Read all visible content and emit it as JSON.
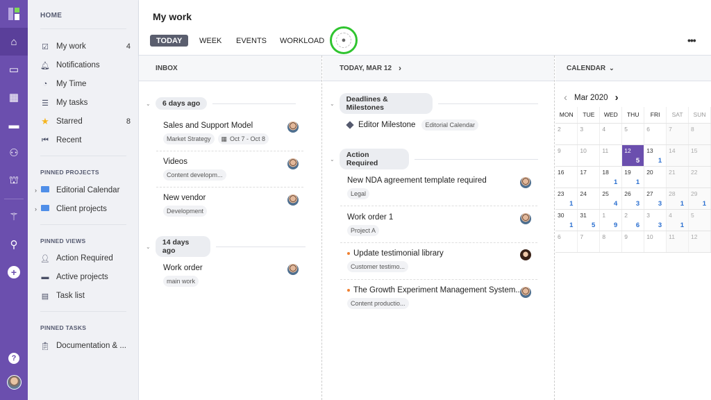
{
  "rail": {
    "icons": [
      "logo-icon",
      "home-icon",
      "briefcase-icon",
      "dashboard-icon",
      "chat-icon",
      "users-icon",
      "bank-icon",
      "magic-wand-icon",
      "search-icon",
      "add-icon",
      "help-icon",
      "user-avatar"
    ],
    "help_label": "?"
  },
  "sidebar": {
    "home_heading": "HOME",
    "home_items": [
      {
        "label": "My work",
        "count": "4",
        "icon": "checkbox-icon"
      },
      {
        "label": "Notifications",
        "count": "",
        "icon": "bell-icon"
      },
      {
        "label": "My Time",
        "count": "",
        "icon": "timer-icon"
      },
      {
        "label": "My tasks",
        "count": "",
        "icon": "checklist-icon"
      },
      {
        "label": "Starred",
        "count": "8",
        "icon": "star-icon"
      },
      {
        "label": "Recent",
        "count": "",
        "icon": "recent-icon"
      }
    ],
    "pinned_projects_heading": "PINNED PROJECTS",
    "pinned_projects": [
      {
        "label": "Editorial Calendar"
      },
      {
        "label": "Client projects"
      }
    ],
    "pinned_views_heading": "PINNED VIEWS",
    "pinned_views": [
      {
        "label": "Action Required"
      },
      {
        "label": "Active projects"
      },
      {
        "label": "Task list"
      }
    ],
    "pinned_tasks_heading": "PINNED TASKS",
    "pinned_tasks": [
      {
        "label": "Documentation & ..."
      }
    ]
  },
  "header": {
    "title": "My work",
    "tabs": [
      {
        "label": "TODAY",
        "active": true
      },
      {
        "label": "WEEK"
      },
      {
        "label": "EVENTS"
      },
      {
        "label": "WORKLOAD"
      }
    ],
    "more_label": "•••",
    "person_icon": "👤"
  },
  "inbox": {
    "heading": "INBOX",
    "groups": [
      {
        "label": "6 days ago",
        "tasks": [
          {
            "title": "Sales and Support Model",
            "tags": [
              "Market Strategy"
            ],
            "date": "Oct 7 - Oct 8"
          },
          {
            "title": "Videos",
            "tags": [
              "Content developm..."
            ]
          },
          {
            "title": "New vendor",
            "tags": [
              "Development"
            ]
          }
        ]
      },
      {
        "label": "14 days ago",
        "tasks": [
          {
            "title": "Work order",
            "tags": [
              "main work"
            ]
          }
        ]
      }
    ]
  },
  "today": {
    "heading": "TODAY, MAR 12",
    "chevron": "›",
    "groups": [
      {
        "label": "Deadlines & Milestones",
        "items": [
          {
            "title": "Editor Milestone",
            "tag": "Editorial Calendar"
          }
        ]
      },
      {
        "label": "Action Required",
        "tasks": [
          {
            "title": "New NDA agreement template required",
            "tag": "Legal",
            "priority": false
          },
          {
            "title": "Work order 1",
            "tag": "Project A",
            "priority": false
          },
          {
            "title": "Update testimonial library",
            "tag": "Customer testimo...",
            "priority": true
          },
          {
            "title": "The Growth Experiment Management System...",
            "tag": "Content productio...",
            "priority": true
          }
        ]
      }
    ]
  },
  "calendar": {
    "heading": "CALENDAR",
    "month": "Mar 2020",
    "prev": "‹",
    "next": "›",
    "weekdays": [
      "MON",
      "TUE",
      "WED",
      "THU",
      "FRI",
      "SAT",
      "SUN"
    ],
    "weeks": [
      [
        {
          "d": "2"
        },
        {
          "d": "3"
        },
        {
          "d": "4"
        },
        {
          "d": "5"
        },
        {
          "d": "6"
        },
        {
          "d": "7"
        },
        {
          "d": "8"
        }
      ],
      [
        {
          "d": "9"
        },
        {
          "d": "10"
        },
        {
          "d": "11"
        },
        {
          "d": "12",
          "n": "5",
          "today": true
        },
        {
          "d": "13",
          "n": "1"
        },
        {
          "d": "14"
        },
        {
          "d": "15"
        }
      ],
      [
        {
          "d": "16"
        },
        {
          "d": "17"
        },
        {
          "d": "18",
          "n": "1"
        },
        {
          "d": "19",
          "n": "1"
        },
        {
          "d": "20"
        },
        {
          "d": "21"
        },
        {
          "d": "22"
        }
      ],
      [
        {
          "d": "23",
          "n": "1"
        },
        {
          "d": "24"
        },
        {
          "d": "25",
          "n": "4"
        },
        {
          "d": "26",
          "n": "3"
        },
        {
          "d": "27",
          "n": "3"
        },
        {
          "d": "28",
          "n": "1"
        },
        {
          "d": "29",
          "n": "1"
        }
      ],
      [
        {
          "d": "30",
          "n": "1"
        },
        {
          "d": "31",
          "n": "5"
        },
        {
          "d": "1",
          "n": "9"
        },
        {
          "d": "2",
          "n": "6"
        },
        {
          "d": "3",
          "n": "3"
        },
        {
          "d": "4",
          "n": "1"
        },
        {
          "d": "5"
        }
      ],
      [
        {
          "d": "6"
        },
        {
          "d": "7"
        },
        {
          "d": "8"
        },
        {
          "d": "9"
        },
        {
          "d": "10"
        },
        {
          "d": "11"
        },
        {
          "d": "12"
        }
      ]
    ],
    "colors": {
      "accent": "#6b4fae",
      "count": "#2a6fd0"
    }
  }
}
